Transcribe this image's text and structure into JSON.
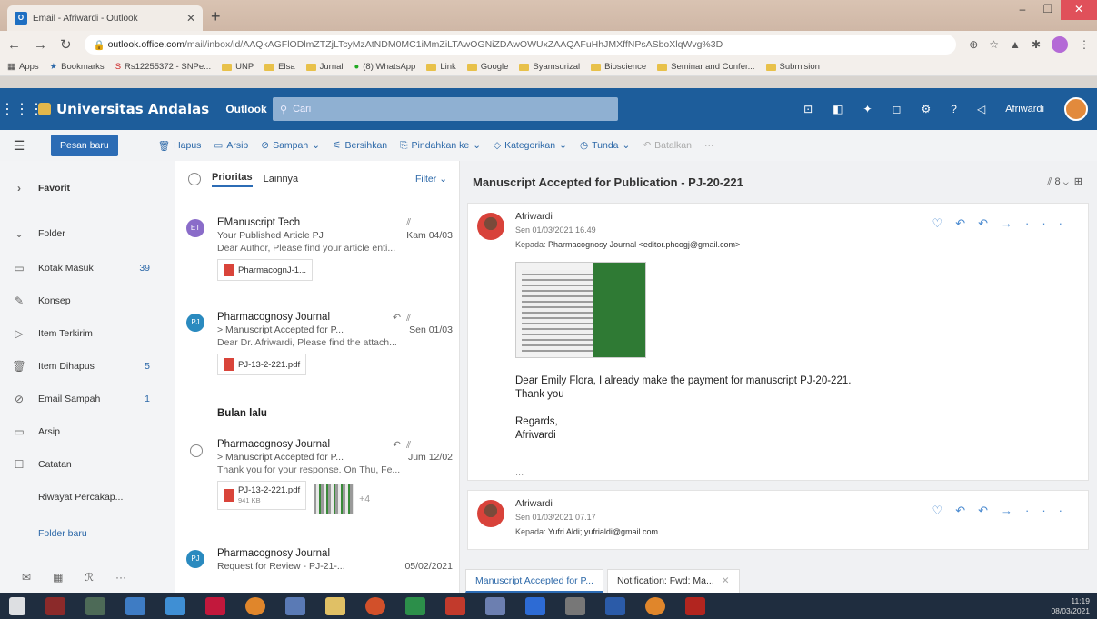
{
  "browser": {
    "tab_title": "Email - Afriwardi - Outlook",
    "tab_icon": "O",
    "url_host": "outlook.office.com",
    "url_path": "/mail/inbox/id/AAQkAGFlODlmZTZjLTcyMzAtNDM0MC1iMmZiLTAwOGNiZDAwOWUxZAAQAFuHhJMXffNPsASboXlqWvg%3D",
    "bookmarks": [
      "Apps",
      "Bookmarks",
      "Rs12255372 - SNPe...",
      "UNP",
      "Elsa",
      "Jurnal",
      "(8) WhatsApp",
      "Link",
      "Google",
      "Syamsurizal",
      "Bioscience",
      "Seminar and Confer...",
      "Submision"
    ]
  },
  "header": {
    "org": "Universitas Andalas",
    "app": "Outlook",
    "search_placeholder": "Cari",
    "user": "Afriwardi"
  },
  "commands": {
    "new_mail": "Pesan baru",
    "delete": "Hapus",
    "archive": "Arsip",
    "junk": "Sampah",
    "sweep": "Bersihkan",
    "move_to": "Pindahkan ke",
    "categorize": "Kategorikan",
    "snooze": "Tunda",
    "undo": "Batalkan",
    "more": "···"
  },
  "nav": {
    "favorites": "Favorit",
    "folders": "Folder",
    "items": [
      {
        "label": "Kotak Masuk",
        "count": "39"
      },
      {
        "label": "Konsep",
        "count": ""
      },
      {
        "label": "Item Terkirim",
        "count": ""
      },
      {
        "label": "Item Dihapus",
        "count": "5"
      },
      {
        "label": "Email Sampah",
        "count": "1"
      },
      {
        "label": "Arsip",
        "count": ""
      },
      {
        "label": "Catatan",
        "count": ""
      },
      {
        "label": "Riwayat Percakap...",
        "count": ""
      }
    ],
    "new_folder": "Folder baru"
  },
  "list": {
    "tab_focused": "Prioritas",
    "tab_other": "Lainnya",
    "filter": "Filter",
    "section_last_month": "Bulan lalu",
    "messages": [
      {
        "initials": "ET",
        "sender": "EManuscript Tech",
        "subject": "Your Published Article PJ",
        "date": "Kam 04/03",
        "preview": "Dear Author, Please find your article enti...",
        "attachment": "PharmacognJ-1..."
      },
      {
        "initials": "PJ",
        "sender": "Pharmacognosy Journal",
        "subject": "> Manuscript Accepted for P...",
        "date": "Sen 01/03",
        "preview": "Dear Dr. Afriwardi, Please find the attach...",
        "attachment": "PJ-13-2-221.pdf"
      },
      {
        "initials": "",
        "sender": "Pharmacognosy Journal",
        "subject": "> Manuscript Accepted for P...",
        "date": "Jum 12/02",
        "preview": "Thank you for your response. On Thu, Fe...",
        "attachment": "PJ-13-2-221.pdf",
        "attachment_size": "941 KB",
        "extra": "+4"
      },
      {
        "initials": "PJ",
        "sender": "Pharmacognosy Journal",
        "subject": "Request for Review - PJ-21-...",
        "date": "05/02/2021",
        "preview": "",
        "attachment": ""
      }
    ]
  },
  "reading": {
    "subject": "Manuscript Accepted for Publication - PJ-20-221",
    "thread_count": "8",
    "mail1": {
      "from": "Afriwardi",
      "date": "Sen 01/03/2021 16.49",
      "to_label": "Kepada:",
      "to": "Pharmacognosy Journal <editor.phcogj@gmail.com>",
      "body1": "Dear Emily Flora, I already make the payment for manuscript PJ-20-221.",
      "body2": "Thank you",
      "body3": "Regards,",
      "body4": "Afriwardi",
      "more": "..."
    },
    "mail2": {
      "from": "Afriwardi",
      "date": "Sen 01/03/2021 07.17",
      "to_label": "Kepada:",
      "to": "Yufri Aldi; yufrialdi@gmail.com"
    },
    "tabs": [
      "Manuscript Accepted for P...",
      "Notification: Fwd: Ma..."
    ]
  },
  "taskbar": {
    "time": "11:19",
    "date": "08/03/2021"
  }
}
